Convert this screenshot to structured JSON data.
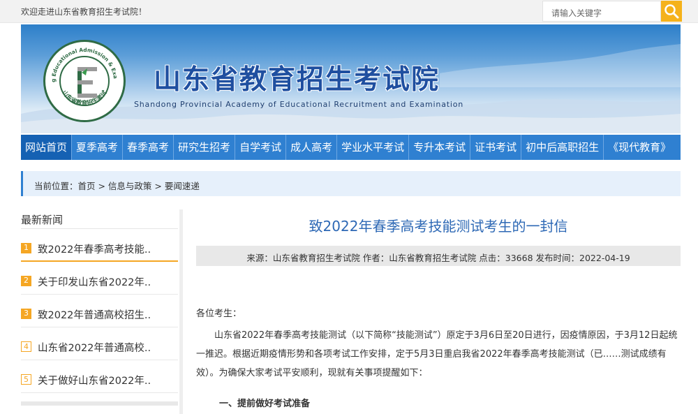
{
  "topbar": {
    "welcome": "欢迎走进山东省教育招生考试院！",
    "search_placeholder": "请输入关键字"
  },
  "banner": {
    "title": "山东省教育招生考试院",
    "subtitle": "Shandong Provincial Academy of Educational Recruitment and Examination",
    "logo_ring_text": "Shandong Educational Admission & Examinations",
    "logo_bottom_text": "山东省教育招生考试"
  },
  "nav": {
    "items": [
      "网站首页",
      "夏季高考",
      "春季高考",
      "研究生招考",
      "自学考试",
      "成人高考",
      "学业水平考试",
      "专升本考试",
      "证书考试",
      "初中后高职招生",
      "《现代教育》"
    ]
  },
  "breadcrumb": "当前位置：首页 > 信息与政策 > 要闻速递",
  "sidebar": {
    "title": "最新新闻",
    "items": [
      {
        "num": "1",
        "text": "致2022年春季高考技能.."
      },
      {
        "num": "2",
        "text": "关于印发山东省2022年.."
      },
      {
        "num": "3",
        "text": "致2022年普通高校招生.."
      },
      {
        "num": "4",
        "text": "山东省2022年普通高校.."
      },
      {
        "num": "5",
        "text": "关于做好山东省2022年.."
      }
    ]
  },
  "article": {
    "title": "致2022年春季高考技能测试考生的一封信",
    "meta": "来源：山东省教育招生考试院 作者：山东省教育招生考试院 点击：33668 发布时间：2022-04-19",
    "greeting": "各位考生：",
    "body": "山东省2022年春季高考技能测试（以下简称“技能测试”）原定于3月6日至20日进行，因疫情原因，于3月12日起统一推迟。根据近期疫情形势和各项考试工作安排，定于5月3日重启我省2022年春季高考技能测试（已……测试成绩有效）。为确保大家考试平安顺利，现就有关事项提醒如下：",
    "section1": "一、提前做好考试准备"
  },
  "colors": {
    "nav_blue": "#2f80d1",
    "nav_active": "#1561b3",
    "accent_orange": "#f5a623",
    "title_blue": "#2d68b5"
  }
}
